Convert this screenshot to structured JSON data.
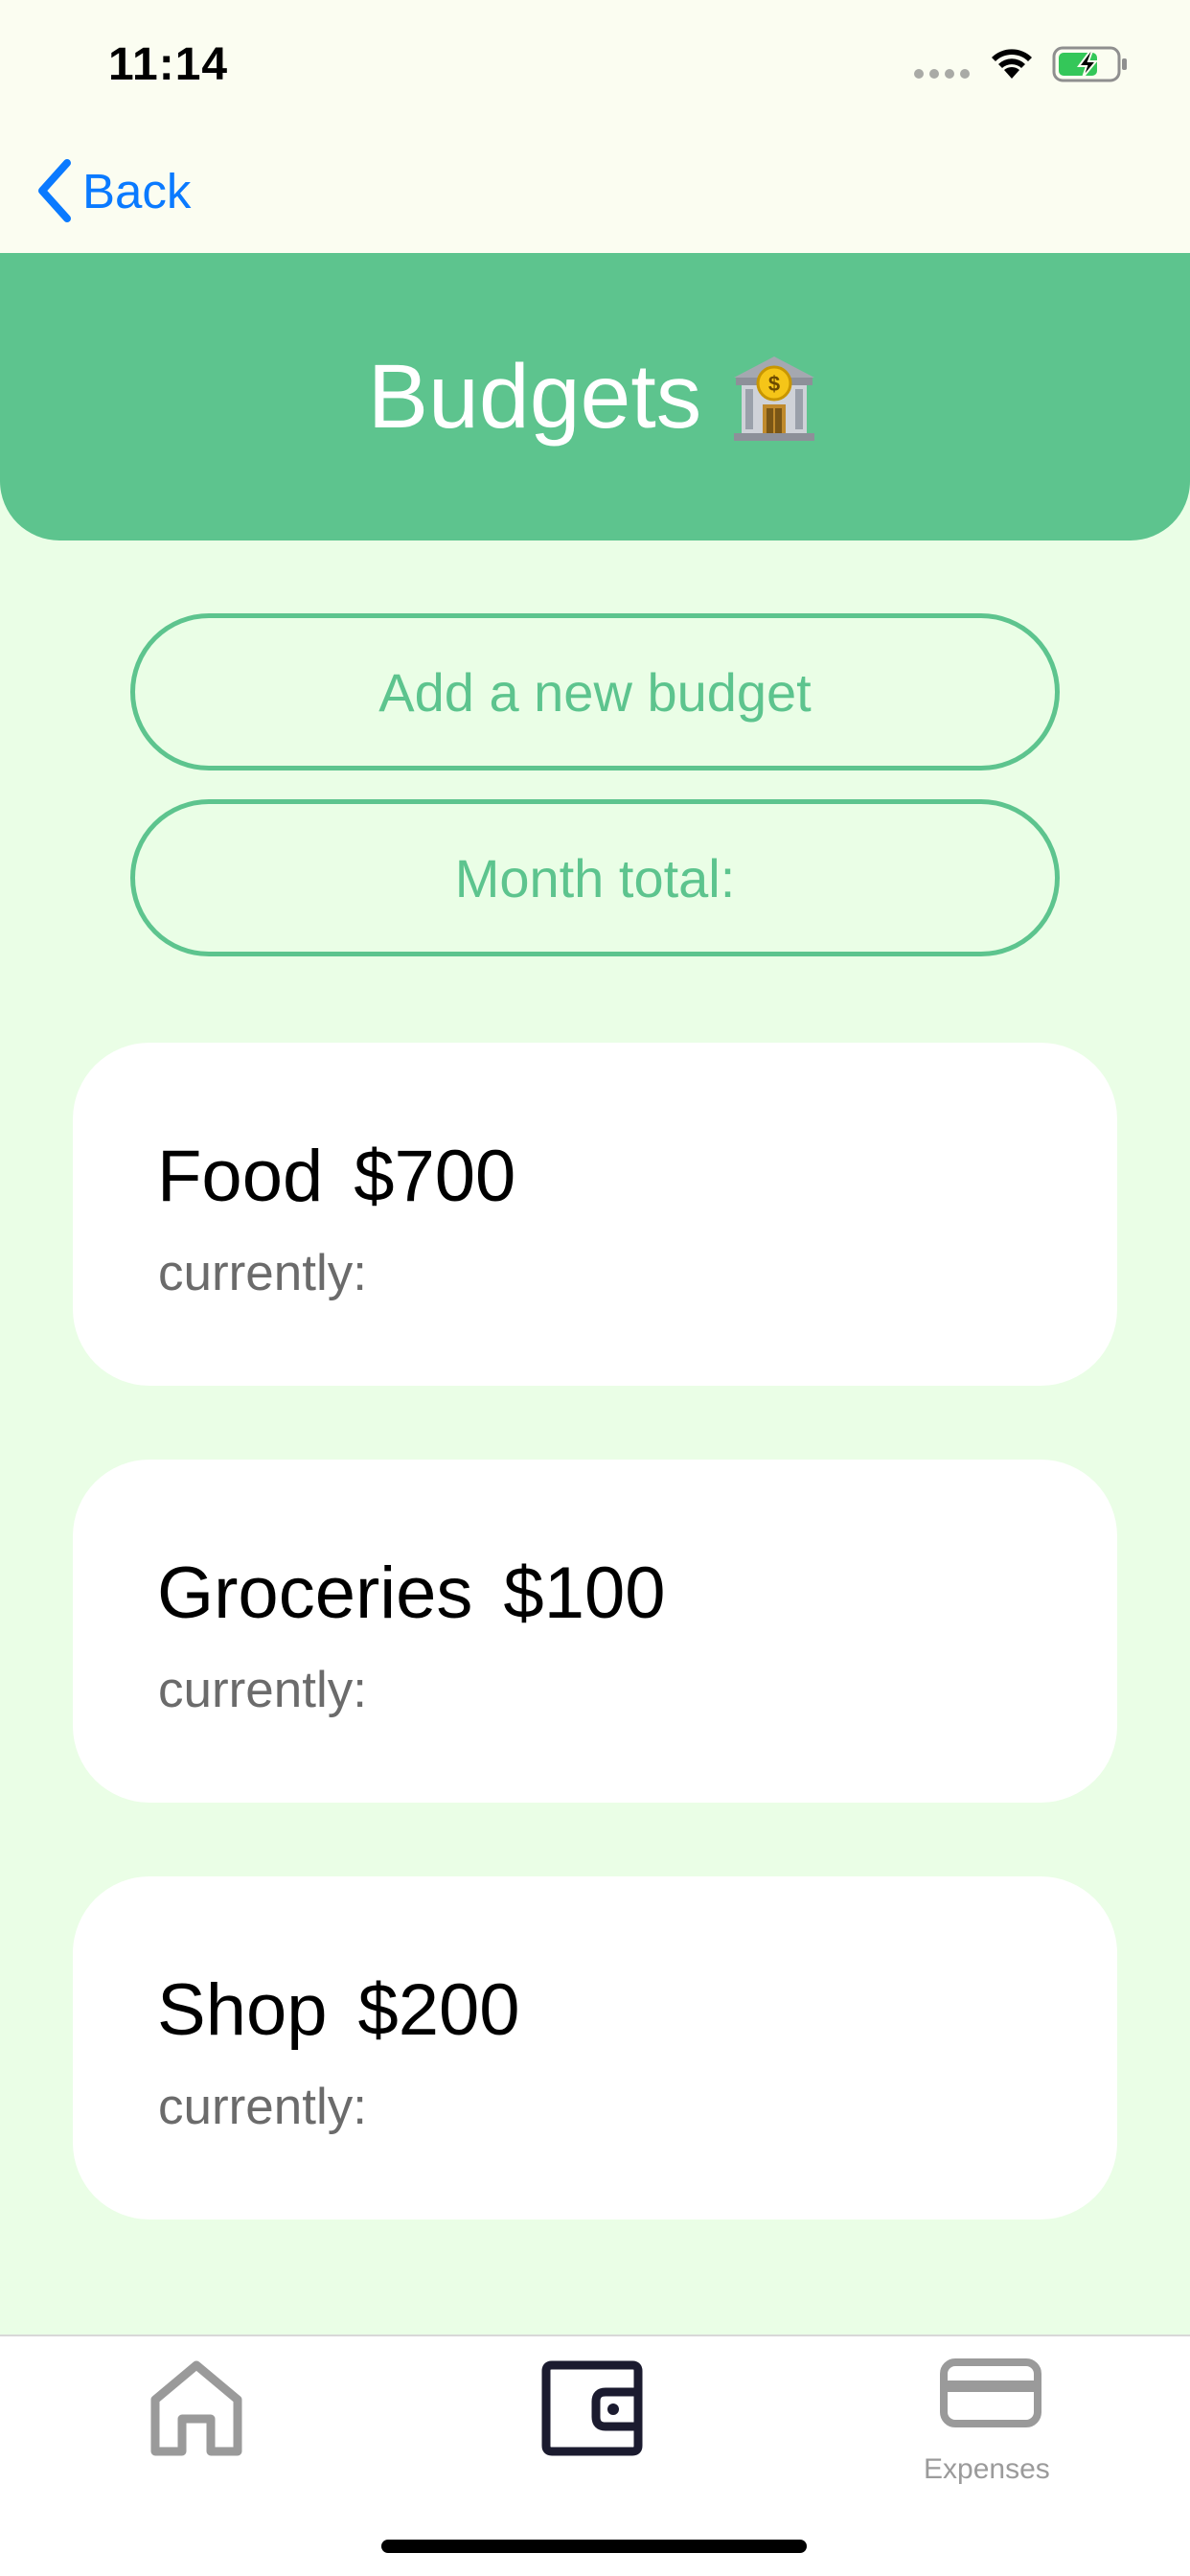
{
  "status_bar": {
    "time": "11:14"
  },
  "nav": {
    "back_label": "Back"
  },
  "header": {
    "title": "Budgets",
    "icon": "bank-emoji-icon"
  },
  "actions": {
    "add_budget_label": "Add a new budget",
    "month_total_label": "Month total:"
  },
  "budgets": [
    {
      "name": "Food",
      "amount": "$700",
      "status": "currently:"
    },
    {
      "name": "Groceries",
      "amount": "$100",
      "status": "currently:"
    },
    {
      "name": "Shop",
      "amount": "$200",
      "status": "currently:"
    }
  ],
  "tabbar": {
    "tabs": [
      {
        "icon": "home-icon",
        "label": ""
      },
      {
        "icon": "wallet-icon",
        "label": "",
        "selected": true
      },
      {
        "icon": "credit-card-icon",
        "label": "Expenses"
      }
    ]
  },
  "colors": {
    "accent": "#5dc48e",
    "background": "#eafee6",
    "link": "#0a7aff",
    "card": "#ffffff"
  }
}
